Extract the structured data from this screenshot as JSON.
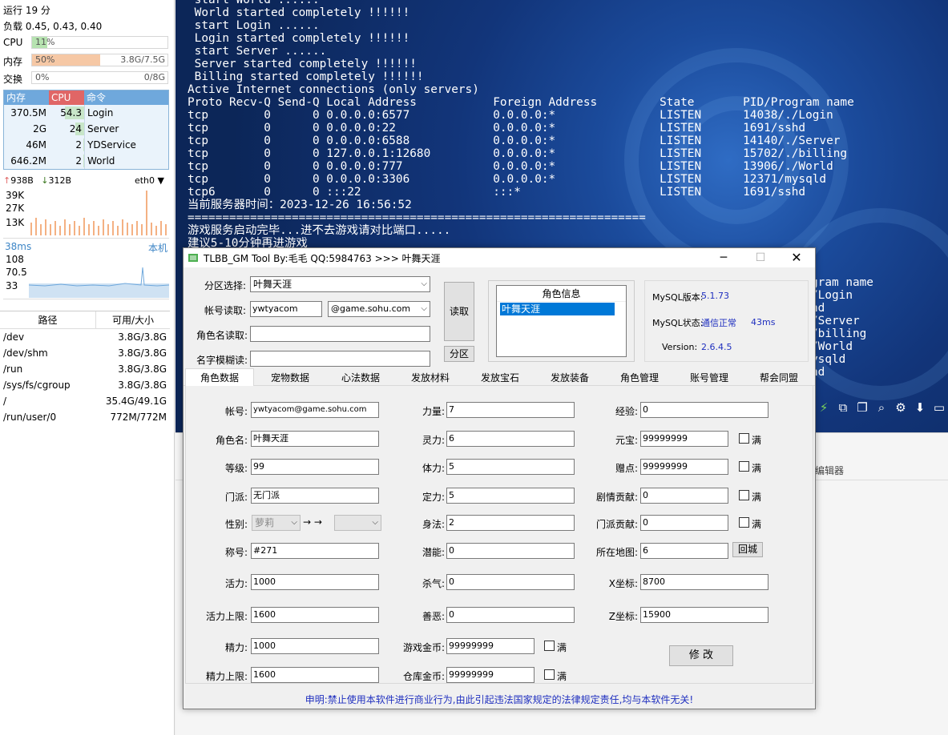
{
  "monitor": {
    "uptime": "运行 19 分",
    "load": "负载 0.45, 0.43, 0.40",
    "cpu": {
      "label": "CPU",
      "percent_text": "11%",
      "fraction": 0.11
    },
    "mem": {
      "label": "内存",
      "percent_text": "50%",
      "right": "3.8G/7.5G",
      "fraction": 0.5
    },
    "swap": {
      "label": "交换",
      "percent_text": "0%",
      "right": "0/8G",
      "fraction": 0.0
    },
    "proc_headers": {
      "mem": "内存",
      "cpu": "CPU",
      "cmd": "命令"
    },
    "procs": [
      {
        "mem": "370.5M",
        "cpu": "54.3",
        "cpu_fraction": 0.54,
        "cmd": "Login"
      },
      {
        "mem": "2G",
        "cpu": "24",
        "cpu_fraction": 0.24,
        "cmd": "Server"
      },
      {
        "mem": "46M",
        "cpu": "2",
        "cpu_fraction": 0.02,
        "cmd": "YDService"
      },
      {
        "mem": "646.2M",
        "cpu": "2",
        "cpu_fraction": 0.02,
        "cmd": "World"
      }
    ],
    "net": {
      "up": "938B",
      "down": "312B",
      "iface": "eth0"
    },
    "net_graph_labels": [
      "39K",
      "27K",
      "13K"
    ],
    "ping": {
      "label": "38ms",
      "host": "本机",
      "labels": [
        "108",
        "70.5",
        "33"
      ]
    },
    "disk_headers": {
      "path": "路径",
      "size": "可用/大小"
    },
    "disks": [
      {
        "path": "/dev",
        "size": "3.8G/3.8G"
      },
      {
        "path": "/dev/shm",
        "size": "3.8G/3.8G"
      },
      {
        "path": "/run",
        "size": "3.8G/3.8G"
      },
      {
        "path": "/sys/fs/cgroup",
        "size": "3.8G/3.8G"
      },
      {
        "path": "/",
        "size": "35.4G/49.1G"
      },
      {
        "path": "/run/user/0",
        "size": "772M/772M"
      }
    ]
  },
  "terminal": {
    "lines": [
      " start World ......",
      " World started completely !!!!!!",
      " start Login ......",
      " Login started completely !!!!!!",
      " start Server ......",
      " Server started completely !!!!!!",
      " Billing started completely !!!!!!",
      "Active Internet connections (only servers)",
      "Proto Recv-Q Send-Q Local Address           Foreign Address         State       PID/Program name",
      "tcp        0      0 0.0.0.0:6577            0.0.0.0:*               LISTEN      14038/./Login",
      "tcp        0      0 0.0.0.0:22              0.0.0.0:*               LISTEN      1691/sshd",
      "tcp        0      0 0.0.0.0:6588            0.0.0.0:*               LISTEN      14140/./Server",
      "tcp        0      0 127.0.0.1:12680         0.0.0.0:*               LISTEN      15702/./billing",
      "tcp        0      0 0.0.0.0:777             0.0.0.0:*               LISTEN      13906/./World",
      "tcp        0      0 0.0.0.0:3306            0.0.0.0:*               LISTEN      12371/mysqld",
      "tcp6       0      0 :::22                   :::*                    LISTEN      1691/sshd",
      "当前服务器时间：2023-12-26 16:56:52",
      "==================================================================",
      "游戏服务启动完毕...进不去游戏请对比端口.....",
      "建议5-10分钟再进游戏"
    ],
    "right_lines": [
      "gram name",
      "/Login",
      "hd",
      "/Server",
      "/billing",
      "/World",
      "ysqld",
      "hd"
    ],
    "below_tab": "编辑器"
  },
  "gm": {
    "title": "TLBB_GM Tool By:毛毛 QQ:5984763 >>> 叶舞天涯",
    "top": {
      "zone_label": "分区选择:",
      "zone_value": "叶舞天涯",
      "account_label": "帐号读取:",
      "account_value": "ywtyacom",
      "domain_value": "@game.sohu.com",
      "role_read_label": "角色名读取:",
      "fuzzy_label": "名字模糊读:",
      "read_button": "读取",
      "zone_button": "分区",
      "role_info_header": "角色信息",
      "role_list": [
        "叶舞天涯"
      ],
      "mysql_version_label": "MySQL版本:",
      "mysql_version": "5.1.73",
      "mysql_status_label": "MySQL状态:",
      "mysql_status": "通信正常",
      "mysql_ping": "43ms",
      "version_label": "Version:",
      "version": "2.6.4.5"
    },
    "tabs": [
      "角色数据",
      "宠物数据",
      "心法数据",
      "发放材料",
      "发放宝石",
      "发放装备",
      "角色管理",
      "账号管理",
      "帮会同盟"
    ],
    "col1": {
      "account": {
        "label": "帐号:",
        "value": "ywtyacom@game.sohu.com"
      },
      "name": {
        "label": "角色名:",
        "value": "叶舞天涯"
      },
      "level": {
        "label": "等级:",
        "value": "99"
      },
      "sect": {
        "label": "门派:",
        "value": "无门派"
      },
      "gender": {
        "label": "性别:",
        "value": "萝莉",
        "arrow": "→ →"
      },
      "title": {
        "label": "称号:",
        "value": "#271"
      },
      "vigor": {
        "label": "活力:",
        "value": "1000"
      },
      "vigor_max": {
        "label": "活力上限:",
        "value": "1600"
      },
      "energy": {
        "label": "精力:",
        "value": "1000"
      },
      "energy_max": {
        "label": "精力上限:",
        "value": "1600"
      }
    },
    "col2": {
      "str": {
        "label": "力量:",
        "value": "7"
      },
      "spi": {
        "label": "灵力:",
        "value": "6"
      },
      "con": {
        "label": "体力:",
        "value": "5"
      },
      "foc": {
        "label": "定力:",
        "value": "5"
      },
      "agi": {
        "label": "身法:",
        "value": "2"
      },
      "pot": {
        "label": "潜能:",
        "value": "0"
      },
      "kill": {
        "label": "杀气:",
        "value": "0"
      },
      "moral": {
        "label": "善恶:",
        "value": "0"
      },
      "gold": {
        "label": "游戏金币:",
        "value": "99999999"
      },
      "bank": {
        "label": "仓库金币:",
        "value": "99999999"
      }
    },
    "col3": {
      "exp": {
        "label": "经验:",
        "value": "0"
      },
      "yuanbao": {
        "label": "元宝:",
        "value": "99999999"
      },
      "gift": {
        "label": "赠点:",
        "value": "99999999"
      },
      "story": {
        "label": "剧情贡献:",
        "value": "0"
      },
      "sectc": {
        "label": "门派贡献:",
        "value": "0"
      },
      "map": {
        "label": "所在地图:",
        "value": "6"
      },
      "x": {
        "label": "X坐标:",
        "value": "8700"
      },
      "z": {
        "label": "Z坐标:",
        "value": "15900"
      }
    },
    "full_label": "满",
    "return_city": "回城",
    "modify": "修 改",
    "footer": "申明:禁止使用本软件进行商业行为,由此引起违法国家规定的法律规定责任,均与本软件无关!"
  }
}
